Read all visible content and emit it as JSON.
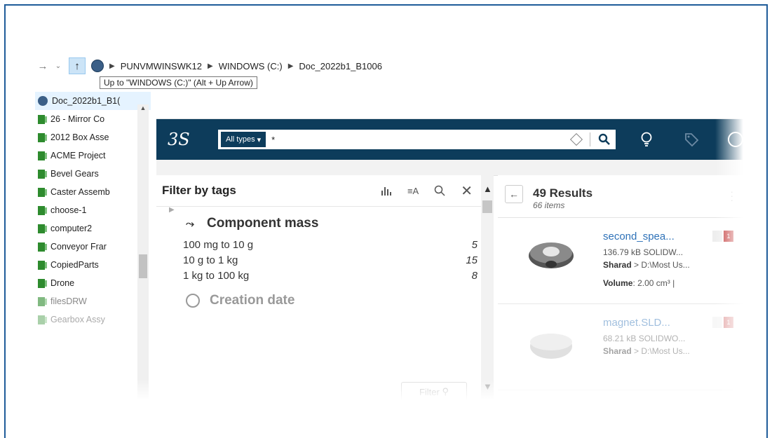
{
  "address_bar": {
    "back_icon": "arrow-right-icon",
    "path": [
      "PUNVMWINSWK12",
      "WINDOWS (C:)",
      "Doc_2022b1_B1006"
    ],
    "tooltip": "Up to \"WINDOWS (C:)\" (Alt + Up Arrow)"
  },
  "tree": {
    "root": "Doc_2022b1_B1(",
    "items": [
      "26 - Mirror Co",
      "2012 Box Asse",
      "ACME Project",
      "Bevel Gears",
      "Caster Assemb",
      "choose-1",
      "computer2",
      "Conveyor Frar",
      "CopiedParts",
      "Drone",
      "filesDRW",
      "Gearbox Assy"
    ]
  },
  "header": {
    "logo": "3S",
    "type_selector": "All types",
    "query": "*"
  },
  "filter": {
    "title": "Filter by tags",
    "section1": {
      "title": "Component mass",
      "rows": [
        {
          "label": "100 mg to 10 g",
          "count": "5"
        },
        {
          "label": "10 g to 1 kg",
          "count": "15"
        },
        {
          "label": "1 kg to 100 kg",
          "count": "8"
        }
      ]
    },
    "section2_title": "Creation date",
    "filter_button": "Filter"
  },
  "results": {
    "title": "49 Results",
    "subtitle": "66 items",
    "items": [
      {
        "name": "second_spea...",
        "size": "136.79 kB SOLIDW...",
        "location_prefix": "Sharad",
        "location": "> D:\\Most Us...",
        "volume_label": "Volume",
        "volume": ": 2.00 cm³ |",
        "badge": "1"
      },
      {
        "name": "magnet.SLD...",
        "size": "68.21 kB SOLIDWO...",
        "location_prefix": "Sharad",
        "location": "> D:\\Most Us...",
        "badge": "1"
      }
    ]
  },
  "colors": {
    "banner": "#0d3c5b",
    "link": "#2f72b8",
    "frame": "#1f5c99"
  }
}
